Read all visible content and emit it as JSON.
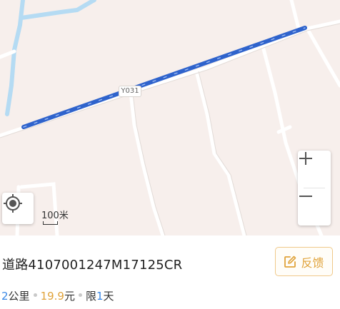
{
  "map": {
    "road_label": "Y031",
    "route_color": "#3b6fd6",
    "scale_label": "100米",
    "zoom_in_symbol": "+",
    "zoom_out_symbol": "−",
    "icons": {
      "locate": "locate-icon",
      "feedback": "edit-icon"
    }
  },
  "panel": {
    "title": "道路4107001247M17125CR",
    "feedback_label": "反馈",
    "accent_color": "#e0a33b",
    "distance_value": "2",
    "distance_unit": "公里",
    "price_value": "19.9",
    "price_unit": "元",
    "limit_prefix": "限",
    "limit_value": "1",
    "limit_unit": "天"
  }
}
